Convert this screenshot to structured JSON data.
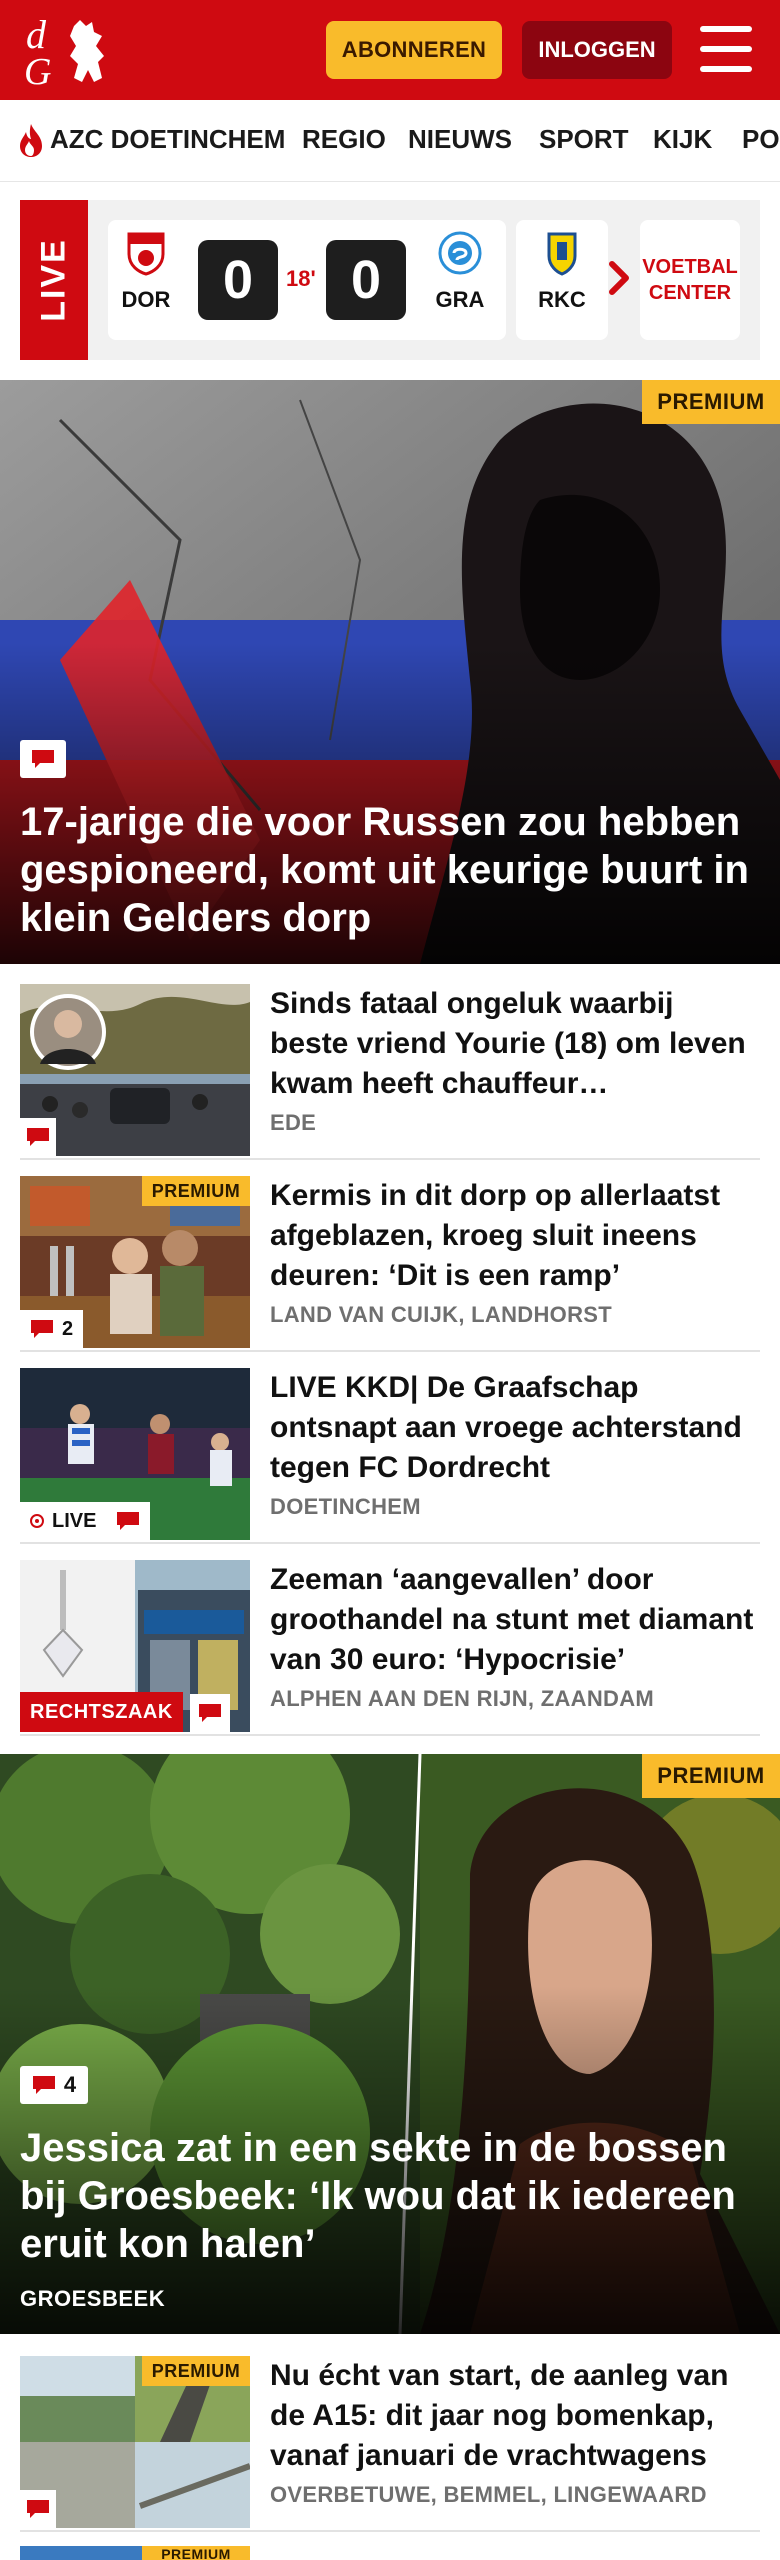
{
  "header": {
    "brand_colors": {
      "red": "#cf0a11",
      "yellow": "#f9bb2b",
      "dark_red": "#8c0510"
    },
    "subscribe_label": "ABONNEREN",
    "login_label": "INLOGGEN",
    "menu_icon": "hamburger-menu-icon"
  },
  "nav": {
    "items": [
      "AZC DOETINCHEM",
      "REGIO",
      "NIEUWS",
      "SPORT",
      "KIJK",
      "PO"
    ]
  },
  "livebar": {
    "live_label": "LIVE",
    "match": {
      "home": "DOR",
      "home_score": "0",
      "minute": "18'",
      "away_score": "0",
      "away": "GRA"
    },
    "next_team": "RKC",
    "voetbal_center": "VOETBAL CENTER"
  },
  "hero1": {
    "premium": "PREMIUM",
    "title": "17-jarige die voor Russen zou hebben gespioneerd, komt uit keurige buurt in klein Gelders dorp"
  },
  "articles": [
    {
      "title": "Sinds fataal ongeluk waarbij beste vriend Yourie (18) om leven kwam heeft chauffeur nachtmerries",
      "location": "EDE",
      "comments": ""
    },
    {
      "title": "Kermis in dit dorp op allerlaatst afgeblazen, kroeg sluit ineens deuren: ‘Dit is een ramp’",
      "location": "LAND VAN CUIJK, LANDHORST",
      "comments": "2",
      "premium": "PREMIUM"
    },
    {
      "title": "LIVE KKD| De Graafschap ontsnapt aan vroege achterstand tegen FC Dordrecht",
      "location": "DOETINCHEM",
      "live": "LIVE"
    },
    {
      "title": "Zeeman ‘aangevallen’ door groothandel na stunt met diamant van 30 euro: ‘Hypocrisie’",
      "location": "ALPHEN AAN DEN RIJN, ZAANDAM",
      "tag": "RECHTSZAAK"
    }
  ],
  "hero2": {
    "premium": "PREMIUM",
    "comments": "4",
    "title": "Jessica zat in een sekte in de bossen bij Groesbeek: ‘Ik wou dat ik iedereen eruit kon halen’",
    "location": "GROESBEEK"
  },
  "article5": {
    "premium": "PREMIUM",
    "title": "Nu écht van start, de aanleg van de A15: dit jaar nog bomenkap, vanaf januari de vrachtwagens",
    "location": "OVERBETUWE, BEMMEL, LINGEWAARD"
  },
  "article6": {
    "premium": "PREMIUM"
  }
}
